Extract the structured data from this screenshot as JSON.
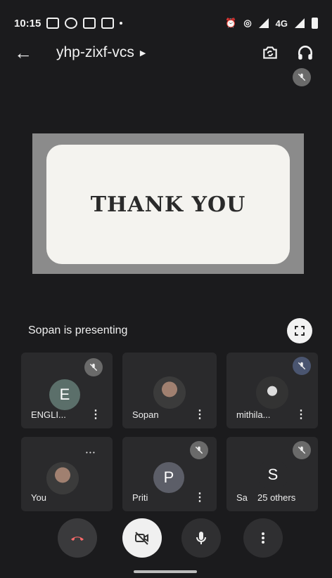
{
  "status": {
    "time": "10:15",
    "network": "4G"
  },
  "header": {
    "meeting_code": "yhp-zixf-vcs"
  },
  "presentation": {
    "slide_text": "THANK YOU",
    "presenter_text": "Sopan is presenting"
  },
  "participants": [
    {
      "name": "ENGLI...",
      "initial": "E"
    },
    {
      "name": "Sopan"
    },
    {
      "name": "mithila..."
    },
    {
      "name": "You"
    },
    {
      "name": "Priti",
      "initial": "P"
    },
    {
      "name": "Sa",
      "initial": "S"
    }
  ],
  "others": {
    "label": "25 others"
  },
  "colors": {
    "background": "#1b1b1d",
    "tile": "#2a2a2c",
    "end_call": "#3a3a3c",
    "camera_off": "#f0f0f0"
  },
  "icons": [
    "back-icon",
    "switch-camera-icon",
    "headphones-icon",
    "mic-off-icon",
    "fullscreen-icon",
    "end-call-icon",
    "camera-off-icon",
    "mic-icon",
    "more-icon"
  ]
}
